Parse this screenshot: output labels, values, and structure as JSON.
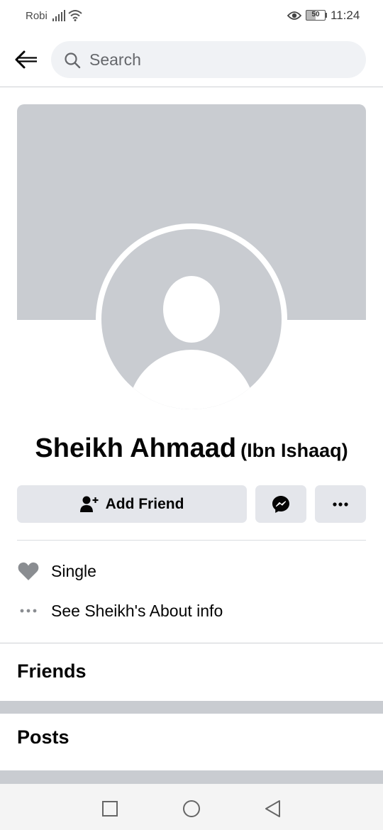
{
  "status_bar": {
    "carrier": "Robi",
    "battery": "50",
    "time": "11:24"
  },
  "header": {
    "search_placeholder": "Search"
  },
  "profile": {
    "name": "Sheikh Ahmaad",
    "alternate_name": "(Ibn Ishaaq)"
  },
  "actions": {
    "add_friend_label": "Add Friend"
  },
  "info": {
    "relationship": "Single",
    "about_link": "See Sheikh's About info"
  },
  "sections": {
    "friends": "Friends",
    "posts": "Posts"
  },
  "colors": {
    "placeholder_gray": "#c9ccd1",
    "button_gray": "#e4e6eb",
    "text_primary": "#050505",
    "text_secondary": "#65676b"
  }
}
